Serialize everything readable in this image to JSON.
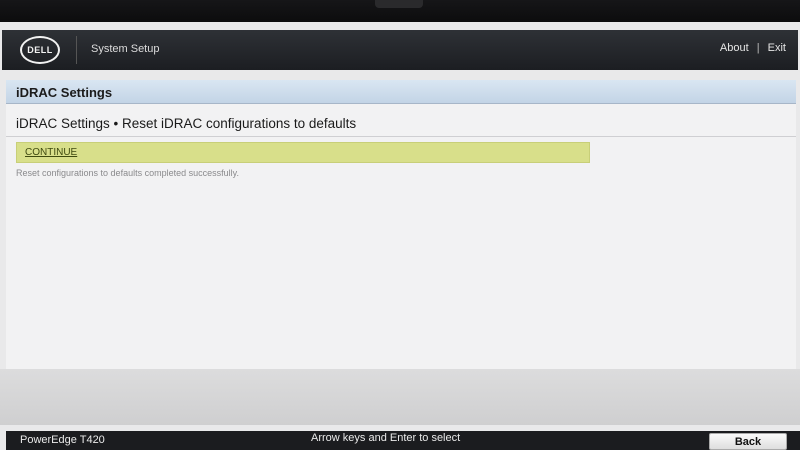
{
  "header": {
    "logo_text": "DELL",
    "app_title": "System Setup",
    "links": {
      "about": "About",
      "separator": "|",
      "exit": "Exit"
    }
  },
  "section": {
    "title": "iDRAC Settings"
  },
  "page": {
    "heading": "iDRAC Settings • Reset iDRAC configurations to defaults",
    "continue_label": "CONTINUE",
    "status_message": "Reset configurations to defaults completed successfully."
  },
  "footer": {
    "model": "PowerEdge T420",
    "hint": "Arrow keys and Enter to select",
    "back_label": "Back"
  },
  "colors": {
    "header_bg": "#1c1e22",
    "section_bar": "#c3d4e6",
    "highlight_row": "#d8df8a",
    "footer_bg": "#1b1c1f"
  }
}
